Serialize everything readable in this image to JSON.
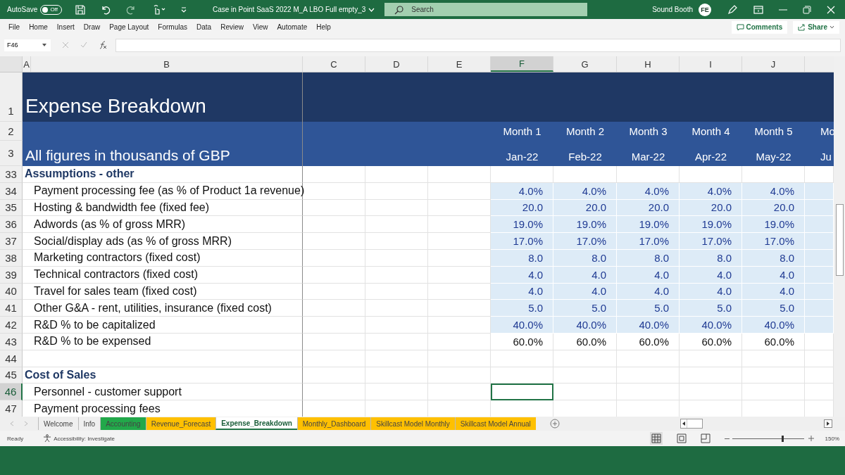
{
  "title_bar": {
    "autosave_label": "AutoSave",
    "autosave": {
      "on": false,
      "label": "Off"
    },
    "title": "Case in Point SaaS 2022 M_A LBO Full empty_3",
    "search": {
      "placeholder": "Search"
    },
    "user": "Sound Booth",
    "avatar": "FE"
  },
  "menu": [
    {
      "label": "File",
      "selected": false
    },
    {
      "label": "Home",
      "selected": false
    },
    {
      "label": "Insert",
      "selected": false
    },
    {
      "label": "Draw",
      "selected": false
    },
    {
      "label": "Page Layout",
      "selected": false
    },
    {
      "label": "Formulas",
      "selected": false
    },
    {
      "label": "Data",
      "selected": false
    },
    {
      "label": "Review",
      "selected": false
    },
    {
      "label": "View",
      "selected": false
    },
    {
      "label": "Automate",
      "selected": false
    },
    {
      "label": "Help",
      "selected": false
    }
  ],
  "comments": "Comments",
  "share": "Share",
  "name_box": "F46",
  "columns": [
    {
      "letter": "A",
      "selected": false
    },
    {
      "letter": "B",
      "selected": false
    },
    {
      "letter": "C",
      "selected": false
    },
    {
      "letter": "D",
      "selected": false
    },
    {
      "letter": "E",
      "selected": false
    },
    {
      "letter": "F",
      "selected": true
    },
    {
      "letter": "G",
      "selected": false
    },
    {
      "letter": "H",
      "selected": false
    },
    {
      "letter": "I",
      "selected": false
    },
    {
      "letter": "J",
      "selected": false
    }
  ],
  "title_row": {
    "row": "1",
    "title": "Expense Breakdown"
  },
  "month_row": {
    "row": "2",
    "months": [
      "Month 1",
      "Month 2",
      "Month 3",
      "Month 4",
      "Month 5",
      "Mo"
    ]
  },
  "date_row": {
    "row": "3",
    "label": "All figures in thousands of GBP",
    "dates": [
      "Jan-22",
      "Feb-22",
      "Mar-22",
      "Apr-22",
      "May-22",
      "Ju"
    ]
  },
  "rows": [
    {
      "row": "33",
      "kind": "section",
      "label": "Assumptions - other",
      "selected": false,
      "cells": [
        {
          "kind": "blank",
          "selected": false
        },
        {
          "kind": "blank",
          "selected": false
        },
        {
          "kind": "blank",
          "selected": false
        },
        {
          "kind": "blank",
          "selected": false
        },
        {
          "kind": "blank",
          "selected": false
        }
      ]
    },
    {
      "row": "34",
      "kind": "item",
      "label": "Payment processing fee (as % of Product 1a revenue)",
      "selected": false,
      "cells": [
        {
          "kind": "input",
          "value": "4.0%",
          "selected": false
        },
        {
          "kind": "input",
          "value": "4.0%",
          "selected": false
        },
        {
          "kind": "input",
          "value": "4.0%",
          "selected": false
        },
        {
          "kind": "input",
          "value": "4.0%",
          "selected": false
        },
        {
          "kind": "input",
          "value": "4.0%",
          "selected": false
        }
      ]
    },
    {
      "row": "35",
      "kind": "item",
      "label": "Hosting & bandwidth fee (fixed fee)",
      "selected": false,
      "cells": [
        {
          "kind": "input",
          "value": "20.0",
          "selected": false
        },
        {
          "kind": "input",
          "value": "20.0",
          "selected": false
        },
        {
          "kind": "input",
          "value": "20.0",
          "selected": false
        },
        {
          "kind": "input",
          "value": "20.0",
          "selected": false
        },
        {
          "kind": "input",
          "value": "20.0",
          "selected": false
        }
      ]
    },
    {
      "row": "36",
      "kind": "item",
      "label": "Adwords (as % of gross MRR)",
      "selected": false,
      "cells": [
        {
          "kind": "input",
          "value": "19.0%",
          "selected": false
        },
        {
          "kind": "input",
          "value": "19.0%",
          "selected": false
        },
        {
          "kind": "input",
          "value": "19.0%",
          "selected": false
        },
        {
          "kind": "input",
          "value": "19.0%",
          "selected": false
        },
        {
          "kind": "input",
          "value": "19.0%",
          "selected": false
        }
      ]
    },
    {
      "row": "37",
      "kind": "item",
      "label": "Social/display ads (as % of gross MRR)",
      "selected": false,
      "cells": [
        {
          "kind": "input",
          "value": "17.0%",
          "selected": false
        },
        {
          "kind": "input",
          "value": "17.0%",
          "selected": false
        },
        {
          "kind": "input",
          "value": "17.0%",
          "selected": false
        },
        {
          "kind": "input",
          "value": "17.0%",
          "selected": false
        },
        {
          "kind": "input",
          "value": "17.0%",
          "selected": false
        }
      ]
    },
    {
      "row": "38",
      "kind": "item",
      "label": "Marketing contractors (fixed cost)",
      "selected": false,
      "cells": [
        {
          "kind": "input",
          "value": "8.0",
          "selected": false
        },
        {
          "kind": "input",
          "value": "8.0",
          "selected": false
        },
        {
          "kind": "input",
          "value": "8.0",
          "selected": false
        },
        {
          "kind": "input",
          "value": "8.0",
          "selected": false
        },
        {
          "kind": "input",
          "value": "8.0",
          "selected": false
        }
      ]
    },
    {
      "row": "39",
      "kind": "item",
      "label": "Technical contractors (fixed cost)",
      "selected": false,
      "cells": [
        {
          "kind": "input",
          "value": "4.0",
          "selected": false
        },
        {
          "kind": "input",
          "value": "4.0",
          "selected": false
        },
        {
          "kind": "input",
          "value": "4.0",
          "selected": false
        },
        {
          "kind": "input",
          "value": "4.0",
          "selected": false
        },
        {
          "kind": "input",
          "value": "4.0",
          "selected": false
        }
      ]
    },
    {
      "row": "40",
      "kind": "item",
      "label": "Travel for sales team (fixed cost)",
      "selected": false,
      "cells": [
        {
          "kind": "input",
          "value": "4.0",
          "selected": false
        },
        {
          "kind": "input",
          "value": "4.0",
          "selected": false
        },
        {
          "kind": "input",
          "value": "4.0",
          "selected": false
        },
        {
          "kind": "input",
          "value": "4.0",
          "selected": false
        },
        {
          "kind": "input",
          "value": "4.0",
          "selected": false
        }
      ]
    },
    {
      "row": "41",
      "kind": "item",
      "label": "Other G&A - rent, utilities, insurance (fixed cost)",
      "selected": false,
      "cells": [
        {
          "kind": "input",
          "value": "5.0",
          "selected": false
        },
        {
          "kind": "input",
          "value": "5.0",
          "selected": false
        },
        {
          "kind": "input",
          "value": "5.0",
          "selected": false
        },
        {
          "kind": "input",
          "value": "5.0",
          "selected": false
        },
        {
          "kind": "input",
          "value": "5.0",
          "selected": false
        }
      ]
    },
    {
      "row": "42",
      "kind": "item",
      "label": "R&D % to be capitalized",
      "selected": false,
      "cells": [
        {
          "kind": "input",
          "value": "40.0%",
          "selected": false
        },
        {
          "kind": "input",
          "value": "40.0%",
          "selected": false
        },
        {
          "kind": "input",
          "value": "40.0%",
          "selected": false
        },
        {
          "kind": "input",
          "value": "40.0%",
          "selected": false
        },
        {
          "kind": "input",
          "value": "40.0%",
          "selected": false
        }
      ]
    },
    {
      "row": "43",
      "kind": "item",
      "label": "R&D % to be expensed",
      "selected": false,
      "cells": [
        {
          "kind": "calc",
          "value": "60.0%",
          "selected": false
        },
        {
          "kind": "calc",
          "value": "60.0%",
          "selected": false
        },
        {
          "kind": "calc",
          "value": "60.0%",
          "selected": false
        },
        {
          "kind": "calc",
          "value": "60.0%",
          "selected": false
        },
        {
          "kind": "calc",
          "value": "60.0%",
          "selected": false
        }
      ]
    },
    {
      "row": "44",
      "kind": "blank",
      "selected": false,
      "cells": [
        {
          "kind": "blank",
          "selected": false
        },
        {
          "kind": "blank",
          "selected": false
        },
        {
          "kind": "blank",
          "selected": false
        },
        {
          "kind": "blank",
          "selected": false
        },
        {
          "kind": "blank",
          "selected": false
        }
      ]
    },
    {
      "row": "45",
      "kind": "section",
      "label": "Cost of Sales",
      "selected": false,
      "cells": [
        {
          "kind": "blank",
          "selected": false
        },
        {
          "kind": "blank",
          "selected": false
        },
        {
          "kind": "blank",
          "selected": false
        },
        {
          "kind": "blank",
          "selected": false
        },
        {
          "kind": "blank",
          "selected": false
        }
      ]
    },
    {
      "row": "46",
      "kind": "item",
      "label": "Personnel - customer support",
      "selected": true,
      "cells": [
        {
          "kind": "blank",
          "selected": true
        },
        {
          "kind": "blank",
          "selected": false
        },
        {
          "kind": "blank",
          "selected": false
        },
        {
          "kind": "blank",
          "selected": false
        },
        {
          "kind": "blank",
          "selected": false
        }
      ]
    },
    {
      "row": "47",
      "kind": "item",
      "label": "Payment processing fees",
      "selected": false,
      "cells": [
        {
          "kind": "blank",
          "selected": false
        },
        {
          "kind": "blank",
          "selected": false
        },
        {
          "kind": "blank",
          "selected": false
        },
        {
          "kind": "blank",
          "selected": false
        },
        {
          "kind": "blank",
          "selected": false
        }
      ]
    }
  ],
  "sheet_tabs": [
    {
      "label": "Welcome",
      "selected": false
    },
    {
      "label": "Info",
      "selected": false
    },
    {
      "label": "Accounting",
      "selected": false,
      "color": "#22a84a"
    },
    {
      "label": "Revenue_Forecast",
      "selected": false,
      "color": "#ffc000"
    },
    {
      "label": "Expense_Breakdown",
      "selected": true
    },
    {
      "label": "Monthly_Dashboard",
      "selected": false,
      "color": "#ffc000"
    },
    {
      "label": "Skillcast Model Monthly",
      "selected": false,
      "color": "#ffc000"
    },
    {
      "label": "Skillcast Model Annual",
      "selected": false,
      "color": "#ffc000"
    }
  ],
  "status_bar": {
    "ready": "Ready",
    "accessibility": "Accessibility: Investigate",
    "zoom": {
      "level": 0.7
    },
    "zoom_label": "150%"
  }
}
